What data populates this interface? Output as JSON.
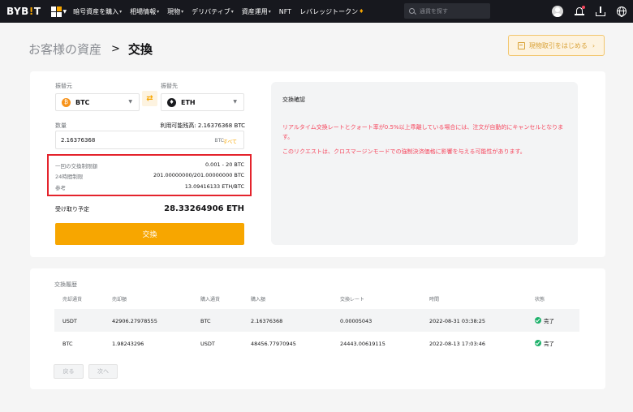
{
  "nav": {
    "logo_a": "BYB",
    "logo_i": "!",
    "logo_b": "T",
    "menu": [
      "暗号資産を購入",
      "相場情報",
      "現物",
      "デリバティブ",
      "資産運用",
      "NFT",
      "レバレッジトークン"
    ],
    "search_placeholder": "通貨を探す"
  },
  "header": {
    "breadcrumb_parent": "お客様の資産",
    "breadcrumb_sep": ">",
    "title": "交換",
    "trade_button": "現物取引をはじめる"
  },
  "form": {
    "from_label": "振替元",
    "from_coin": "BTC",
    "to_label": "振替先",
    "to_coin": "ETH",
    "qty_label": "数量",
    "available": "利用可能残高: 2.16376368 BTC",
    "qty_value": "2.16376368",
    "qty_unit": "BTC",
    "max_label": "すべて",
    "limits": [
      {
        "k": "一回の交換制限額",
        "v": "0.001 - 20 BTC"
      },
      {
        "k": "24時間制限",
        "v": "201.00000000/201.00000000 BTC"
      },
      {
        "k": "参考",
        "v": "13.09416133 ETH/BTC"
      }
    ],
    "receive_label": "受け取り予定",
    "receive_value": "28.33264906 ETH",
    "exchange_button": "交換"
  },
  "confirm": {
    "title": "交換確認",
    "msg1": "リアルタイム交換レートとクォート率が0.5%以上乖離している場合には、注文が自動的にキャンセルとなります。",
    "msg2": "このリクエストは、クロスマージンモードでの強制決済価格に影響を与える可能性があります。"
  },
  "history": {
    "title": "交換履歴",
    "headers": [
      "売却通貨",
      "売却額",
      "購入通貨",
      "購入額",
      "交換レート",
      "時間",
      "状態"
    ],
    "rows": [
      {
        "sell_coin": "USDT",
        "sell_amt": "42906.27978555",
        "buy_coin": "BTC",
        "buy_amt": "2.16376368",
        "rate": "0.00005043",
        "time": "2022-08-31 03:38:25",
        "status": "完了"
      },
      {
        "sell_coin": "BTC",
        "sell_amt": "1.98243296",
        "buy_coin": "USDT",
        "buy_amt": "48456.77970945",
        "rate": "24443.00619115",
        "time": "2022-08-13 17:03:46",
        "status": "完了"
      }
    ],
    "prev": "戻る",
    "next": "次へ"
  },
  "colors": {
    "accent": "#f7a600",
    "warning": "#f6465d",
    "success": "#20b26c",
    "highlight_box": "#e4232c"
  }
}
